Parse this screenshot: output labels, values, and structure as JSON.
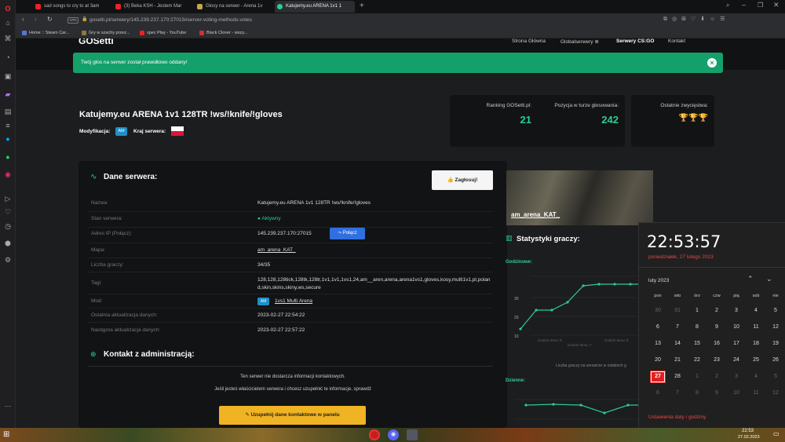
{
  "browser": {
    "tabs": [
      {
        "label": "sad songs to cry to at 3am"
      },
      {
        "label": "(3) Beka KSH - Jestem Mar"
      },
      {
        "label": "Głosy na serwer - Arena 1v"
      },
      {
        "label": "Katujemy.eu ARENA 1v1 1"
      }
    ],
    "url": "gosetti.pl/serwery/145.239.237.170:27015#server-voting-methods-votes",
    "bookmarks": [
      {
        "label": "Home :: Steam Car..."
      },
      {
        "label": "Gry w szachy przez..."
      },
      {
        "label": "spec Play - YouTube"
      },
      {
        "label": "Black Clover - wszy..."
      }
    ]
  },
  "site": {
    "logo": "GOSetti",
    "nav": [
      "Strona Główna",
      "Globalserwery ⊕",
      "Serwery CS:GO",
      "Kontakt"
    ],
    "toast": "Twój głos na serwer został prawidłowo oddany!",
    "server_title": "Katujemy.eu ARENA 1v1 128TR !ws/!knife/!gloves",
    "mod_label": "Modyfikacja:",
    "mod_value": "AM",
    "country_label": "Kraj serwera:",
    "stats": [
      {
        "label": "Ranking GOSetti.pl:",
        "value": "21"
      },
      {
        "label": "Pozycja w turze głosowania:",
        "value": "242"
      },
      {
        "label": "Ostatnie zwycięstwa:",
        "value": "🏆🏆🏆"
      }
    ],
    "details_title": "Dane serwera:",
    "vote_button": "Zagłosuj!",
    "details": [
      {
        "label": "Nazwa:",
        "value": "Katujemy.eu ARENA 1v1 128TR !ws/!knife/!gloves"
      },
      {
        "label": "Stan serwera:",
        "value": "Aktywny"
      },
      {
        "label": "Adres IP (Połącz):",
        "value": "145.239.237.170:27015"
      },
      {
        "label": "Mapa:",
        "value": "am_arena_KAT_"
      },
      {
        "label": "Liczba graczy:",
        "value": "34/35"
      },
      {
        "label": "Tagi:",
        "value": "128,128,128tick,128tk,128tr,1v1,1v1,1vs1,24,am__aren,arena,arena1vs1,gloves,kosy,multi1v1,pl,poland,skin,skins,skiny,ws,secure"
      },
      {
        "label": "Mod:",
        "value": "1vs1 Multi Arena",
        "badge": "AM"
      },
      {
        "label": "Ostatnia aktualizacja danych:",
        "value": "2023-02-27 22:54:22"
      },
      {
        "label": "Następna aktualizacja danych:",
        "value": "2023-02-27 22:57:22"
      }
    ],
    "connect_button": "Połącz",
    "contact_title": "Kontakt z administracją:",
    "contact_text1": "Ten serwer nie dostarcza informacji kontaktowych.",
    "contact_text2": "Jeśli jesteś właścicielem serwera i chcesz uzupełnić te informacje, sprawdź",
    "contact_button": "Uzupełnij dane kontaktowe w panelu",
    "map_name": "am_arena_KAT_",
    "players_title": "Statystyki graczy:",
    "hourly_label": "Godzinowe:",
    "daily_label": "Dzienne:",
    "chart_caption": "Liczba graczy na serwerze w ostatnich g",
    "axis": [
      "30",
      "20",
      "10"
    ],
    "x_labels": [
      "Godzin temu: 9",
      "Godzin temu: 7",
      "Godzin temu: 5"
    ]
  },
  "calendar": {
    "time": "22:53:57",
    "date": "poniedziałek, 27 lutego 2023",
    "month": "luty 2023",
    "weekdays": [
      "pon",
      "wto",
      "śro",
      "czw",
      "pią",
      "sob",
      "nie"
    ],
    "weeks": [
      [
        "30",
        "31",
        "1",
        "2",
        "3",
        "4",
        "5"
      ],
      [
        "6",
        "7",
        "8",
        "9",
        "10",
        "11",
        "12"
      ],
      [
        "13",
        "14",
        "15",
        "16",
        "17",
        "18",
        "19"
      ],
      [
        "20",
        "21",
        "22",
        "23",
        "24",
        "25",
        "26"
      ],
      [
        "27",
        "28",
        "1",
        "2",
        "3",
        "4",
        "5"
      ],
      [
        "6",
        "7",
        "8",
        "9",
        "10",
        "11",
        "12"
      ]
    ],
    "settings": "Ustawienia daty i godziny"
  },
  "taskbar": {
    "time": "22:53",
    "date": "27.02.2023"
  },
  "colors": {
    "accent": "#2ecc91",
    "toast": "#14a06b",
    "vote_btn": "#f5f5f5",
    "connect_btn": "#2f6fe0",
    "contact_btn": "#f0b323",
    "today": "#e02020"
  }
}
